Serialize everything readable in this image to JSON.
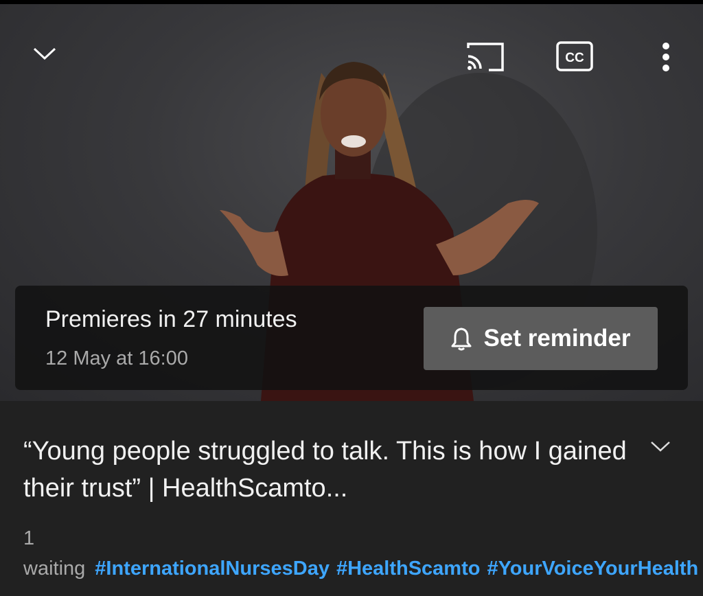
{
  "player": {
    "collapse_icon": "chevron-down-icon",
    "cast_icon": "cast-icon",
    "captions_icon": "closed-captions-icon",
    "captions_text": "CC",
    "more_icon": "more-vertical-icon"
  },
  "premiere": {
    "title": "Premieres in 27 minutes",
    "date": "12 May at 16:00",
    "reminder_label": "Set reminder",
    "reminder_icon": "bell-icon"
  },
  "video_info": {
    "title": "“Young people struggled to talk. This is how I gained their trust” | HealthScamto...",
    "waiting": "1 waiting",
    "hashtags": [
      "#InternationalNursesDay",
      "#HealthScamto",
      "#YourVoiceYourHealth"
    ],
    "expand_icon": "chevron-down-icon"
  },
  "colors": {
    "background": "#212121",
    "link": "#3ea6ff",
    "button": "#5c5c5c"
  }
}
